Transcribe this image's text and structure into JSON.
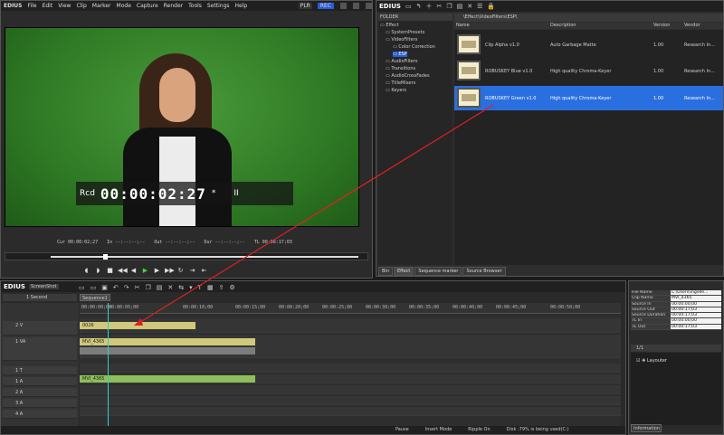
{
  "player": {
    "logo": "EDIUS",
    "menu": [
      "File",
      "Edit",
      "View",
      "Clip",
      "Marker",
      "Mode",
      "Capture",
      "Render",
      "Tools",
      "Settings",
      "Help"
    ],
    "plr": "PLR",
    "rec": "REC",
    "overlay_label": "Rcd",
    "timecode": "00:00:02:27",
    "overlay_mark": "*",
    "overlay_pause": "II",
    "cur_label": "Cur",
    "cur_value": "00:00:02;27",
    "in_label": "In",
    "in_value": "--:--:--;--",
    "out_label": "Out",
    "out_value": "--:--:--;--",
    "dur_label": "Dur",
    "dur_value": "--:--:--;--",
    "ttl_label": "TL",
    "ttl_value": "00:00:17;03"
  },
  "bin": {
    "logo": "EDIUS",
    "folder_header": "FOLDER",
    "path": "\\Effect\\VideoFilters\\ESP\\",
    "tree": [
      {
        "label": "Effect",
        "indent": 0
      },
      {
        "label": "SystemPresets",
        "indent": 1
      },
      {
        "label": "VideoFilters",
        "indent": 1
      },
      {
        "label": "Color Correction",
        "indent": 2
      },
      {
        "label": "ESP",
        "indent": 2,
        "selected": true
      },
      {
        "label": "AudioFilters",
        "indent": 1
      },
      {
        "label": "Transitions",
        "indent": 1
      },
      {
        "label": "AudioCrossFades",
        "indent": 1
      },
      {
        "label": "TitleMixers",
        "indent": 1
      },
      {
        "label": "Keyers",
        "indent": 1
      }
    ],
    "columns": {
      "name": "Name",
      "description": "Description",
      "version": "Version",
      "vendor": "Vendor"
    },
    "rows": [
      {
        "name": "Clip Alpha v1.0",
        "description": "Auto Garbage Matte",
        "version": "1.00",
        "vendor": "Research In..."
      },
      {
        "name": "ROBUSKEY Blue v1.0",
        "description": "High quality Chroma-Keyer",
        "version": "1.00",
        "vendor": "Research In..."
      },
      {
        "name": "ROBUSKEY Green v1.0",
        "description": "High quality Chroma-Keyer",
        "version": "1.00",
        "vendor": "Research In...",
        "selected": true
      }
    ],
    "tabs": [
      "Bin",
      "Effect",
      "Sequence marker",
      "Source Browser"
    ]
  },
  "timeline": {
    "logo": "EDIUS",
    "project": "ScreenShot",
    "sequence_tab": "Sequence1",
    "scale": "1 Second",
    "ruler": [
      "00:00:00;00",
      "00:00:05;00",
      "00:00:10;00",
      "00:00:15;00",
      "00:00:20;00",
      "00:00:25;00",
      "00:00:30;00",
      "00:00:35;00",
      "00:00:40;00",
      "00:00:45;00",
      "00:00:50;00"
    ],
    "tracks": [
      "2 V",
      "1 VA",
      "1 T",
      "1 A",
      "2 A",
      "3 A",
      "4 A"
    ],
    "clips": {
      "v2": "0026",
      "va1": "MVI_4365",
      "a1": "MVI_4365"
    },
    "status": {
      "pause": "Pause",
      "insert": "Insert Mode",
      "ripple": "Ripple On",
      "disk": "Disk :79% is being used(C:)"
    }
  },
  "info": {
    "rows": [
      {
        "k": "File Name",
        "v": "C:\\Users\\ingelle..."
      },
      {
        "k": "Clip Name",
        "v": "MVI_4365"
      },
      {
        "k": "Source In",
        "v": "00:00:00;00"
      },
      {
        "k": "Source Out",
        "v": "00:00:17;03"
      },
      {
        "k": "Source Duration",
        "v": "00:00:17;03"
      },
      {
        "k": "TL In",
        "v": "00:00:00;00"
      },
      {
        "k": "TL Out",
        "v": "00:00:17;03"
      }
    ],
    "layer_header": "1/1",
    "layer_item": "Layouter",
    "tab": "Information"
  }
}
